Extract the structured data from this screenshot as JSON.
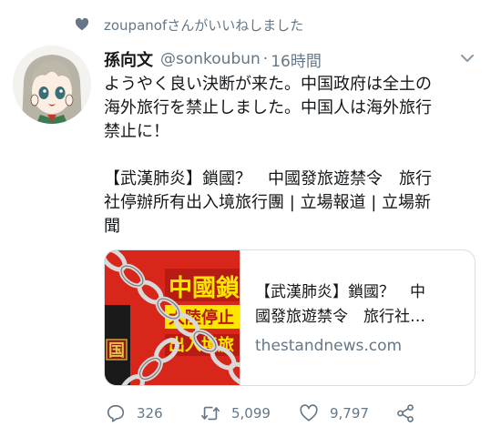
{
  "liked_by": {
    "text": "zoupanofさんがいいねしました",
    "icon": "heart-icon"
  },
  "tweet": {
    "display_name": "孫向文",
    "handle": "@sonkoubun",
    "separator": "·",
    "time": "16時間",
    "lines": [
      "ようやく良い決断が来た。中国政府は全土の",
      "海外旅行を禁止しました。中国人は海外旅行",
      "禁止に！",
      "",
      "【武漢肺炎】鎖國？　中國發旅遊禁令　旅行",
      "社停辦所有出入境旅行團 | 立場報道 | 立場新",
      "聞"
    ]
  },
  "card": {
    "title_lines": [
      "【武漢肺炎】鎖國？　中",
      "國發旅遊禁令　旅行社…"
    ],
    "domain": "thestandnews.com",
    "thumb_text": {
      "line1": "中國鎖",
      "line2": "大陸停止",
      "line3": "出入境旅",
      "side": "国"
    }
  },
  "actions": {
    "reply": {
      "count": "326",
      "icon": "reply-icon"
    },
    "retweet": {
      "count": "5,099",
      "icon": "retweet-icon"
    },
    "like": {
      "count": "9,797",
      "icon": "heart-outline-icon"
    },
    "share": {
      "icon": "share-icon"
    }
  },
  "colors": {
    "text": "#14171a",
    "muted": "#657786",
    "border": "#d8dee3",
    "thumb_red": "#d8261b"
  }
}
